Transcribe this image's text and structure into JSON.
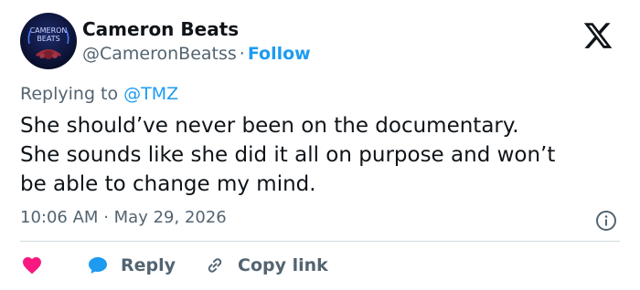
{
  "author": {
    "display_name": "Cameron Beats",
    "handle": "@CameronBeatss",
    "separator": "·",
    "follow_label": "Follow",
    "avatar_text_line1": "CAMERON",
    "avatar_text_line2": "BEATS"
  },
  "reply_context": {
    "label": "Replying to",
    "target": "@TMZ"
  },
  "tweet": {
    "lines": [
      "She should’ve never been on the documentary.",
      "She sounds like she did it all on purpose and won’t",
      "be able to change my mind."
    ],
    "time": "10:06 AM",
    "separator": "·",
    "date": "May 29, 2026"
  },
  "actions": {
    "like_label": "",
    "reply_label": "Reply",
    "copy_link_label": "Copy link"
  },
  "icons": {
    "brand": "x-logo-icon",
    "info": "info-icon",
    "like": "heart-icon",
    "reply": "speech-bubble-icon",
    "copy_link": "link-icon"
  },
  "colors": {
    "text_primary": "#0f1419",
    "text_secondary": "#536471",
    "accent_blue": "#1d9bf0",
    "like_red": "#f91880",
    "divider": "#cfd9de",
    "avatar_bg": "#0b1030"
  }
}
